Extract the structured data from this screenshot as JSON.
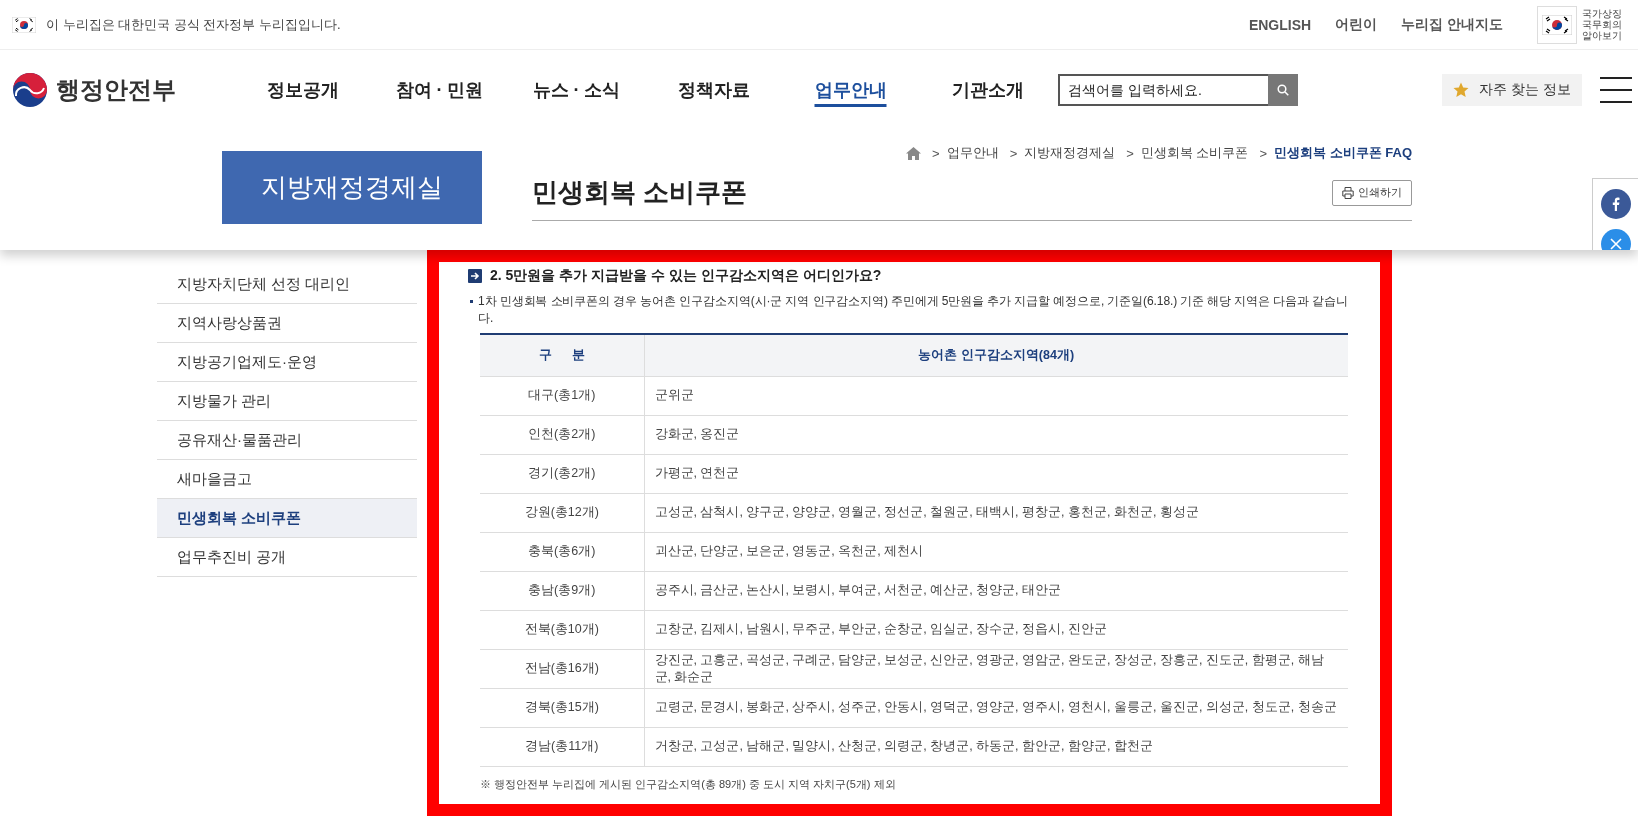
{
  "top_bar": {
    "notice": "이 누리집은 대한민국 공식 전자정부 누리집입니다.",
    "links": [
      "ENGLISH",
      "어린이",
      "누리집 안내지도"
    ],
    "symbol_link": "국가상징 국무회의 알아보기"
  },
  "header": {
    "logo_text": "행정안전부",
    "nav": [
      {
        "label": "정보공개",
        "selected": false
      },
      {
        "label": "참여 · 민원",
        "selected": false
      },
      {
        "label": "뉴스 · 소식",
        "selected": false
      },
      {
        "label": "정책자료",
        "selected": false
      },
      {
        "label": "업무안내",
        "selected": true
      },
      {
        "label": "기관소개",
        "selected": false
      }
    ],
    "search": {
      "placeholder": "검색어를 입력하세요."
    },
    "favorites_button": "자주 찾는 정보"
  },
  "subheader": {
    "section_title": "지방재정경제실",
    "breadcrumb": [
      {
        "separator": ">",
        "label": "업무안내",
        "current": false
      },
      {
        "separator": ">",
        "label": "지방재정경제실",
        "current": false
      },
      {
        "separator": ">",
        "label": "민생회복 소비쿠폰",
        "current": false
      },
      {
        "separator": ">",
        "label": "민생회복 소비쿠폰 FAQ",
        "current": true
      }
    ],
    "page_title": "민생회복 소비쿠폰",
    "print_button": "인쇄하기"
  },
  "sidebar": {
    "items": [
      {
        "label": "지방자치단체 선정 대리인",
        "selected": false
      },
      {
        "label": "지역사랑상품권",
        "selected": false
      },
      {
        "label": "지방공기업제도·운영",
        "selected": false
      },
      {
        "label": "지방물가 관리",
        "selected": false
      },
      {
        "label": "공유재산·물품관리",
        "selected": false
      },
      {
        "label": "새마을금고",
        "selected": false
      },
      {
        "label": "민생회복 소비쿠폰",
        "selected": true
      },
      {
        "label": "업무추진비 공개",
        "selected": false
      }
    ]
  },
  "content": {
    "question": "2. 5만원을 추가 지급받을 수 있는 인구감소지역은 어디인가요?",
    "answer": "1차 민생회복 소비쿠폰의 경우 농어촌 인구감소지역(시·군 지역 인구감소지역) 주민에게 5만원을 추가 지급할 예정으로, 기준일(6.18.) 기준 해당 지역은 다음과 같습니다.",
    "table": {
      "columns": [
        "구 분",
        "농어촌 인구감소지역(84개)"
      ],
      "rows": [
        [
          "대구(총1개)",
          "군위군"
        ],
        [
          "인천(총2개)",
          "강화군, 옹진군"
        ],
        [
          "경기(총2개)",
          "가평군, 연천군"
        ],
        [
          "강원(총12개)",
          "고성군, 삼척시, 양구군, 양양군, 영월군, 정선군, 철원군, 태백시, 평창군, 홍천군, 화천군, 횡성군"
        ],
        [
          "충북(총6개)",
          "괴산군, 단양군, 보은군, 영동군, 옥천군, 제천시"
        ],
        [
          "충남(총9개)",
          "공주시, 금산군, 논산시, 보령시, 부여군, 서천군, 예산군, 청양군, 태안군"
        ],
        [
          "전북(총10개)",
          "고창군, 김제시, 남원시, 무주군, 부안군, 순창군, 임실군, 장수군, 정읍시, 진안군"
        ],
        [
          "전남(총16개)",
          "강진군, 고흥군, 곡성군, 구례군, 담양군, 보성군, 신안군, 영광군, 영암군, 완도군, 장성군, 장흥군, 진도군, 함평군, 해남군, 화순군"
        ],
        [
          "경북(총15개)",
          "고령군, 문경시, 봉화군, 상주시, 성주군, 안동시, 영덕군, 영양군, 영주시, 영천시, 울릉군, 울진군, 의성군, 청도군, 청송군"
        ],
        [
          "경남(총11개)",
          "거창군, 고성군, 남해군, 밀양시, 산청군, 의령군, 창녕군, 하동군, 함안군, 함양군, 합천군"
        ]
      ]
    },
    "note": "※ 행정안전부 누리집에 게시된 인구감소지역(총 89개) 중 도시 지역 자치구(5개) 제외"
  }
}
